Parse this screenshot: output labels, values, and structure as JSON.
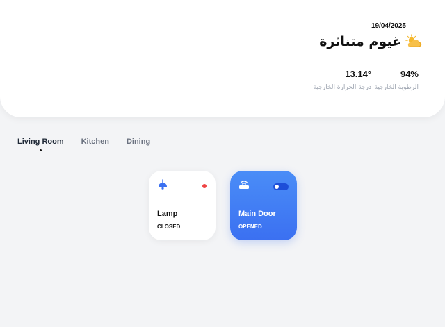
{
  "weather": {
    "date": "19/04/2025",
    "condition": "غيوم متناثرة",
    "condition_icon": "partly-cloudy-icon",
    "humidity": {
      "value": "94%",
      "label": "الرطوبة الخارجية"
    },
    "temperature": {
      "value": "13.14°",
      "label": "درجة الحرارة الخارجية"
    }
  },
  "rooms": {
    "tabs": [
      {
        "label": "Living Room",
        "active": true
      },
      {
        "label": "Kitchen",
        "active": false
      },
      {
        "label": "Dining",
        "active": false
      }
    ]
  },
  "devices": [
    {
      "name": "Lamp",
      "state": "CLOSED",
      "icon": "ceiling-lamp-icon",
      "indicator": "status-dot",
      "indicator_color": "#ef4444"
    },
    {
      "name": "Main Door",
      "state": "OPENED",
      "icon": "router-door-icon",
      "indicator": "toggle",
      "toggle_on": true
    }
  ],
  "colors": {
    "accent": "#3b70f1",
    "background": "#f3f4f6",
    "status_off": "#ef4444",
    "sun": "#f5b82e"
  }
}
